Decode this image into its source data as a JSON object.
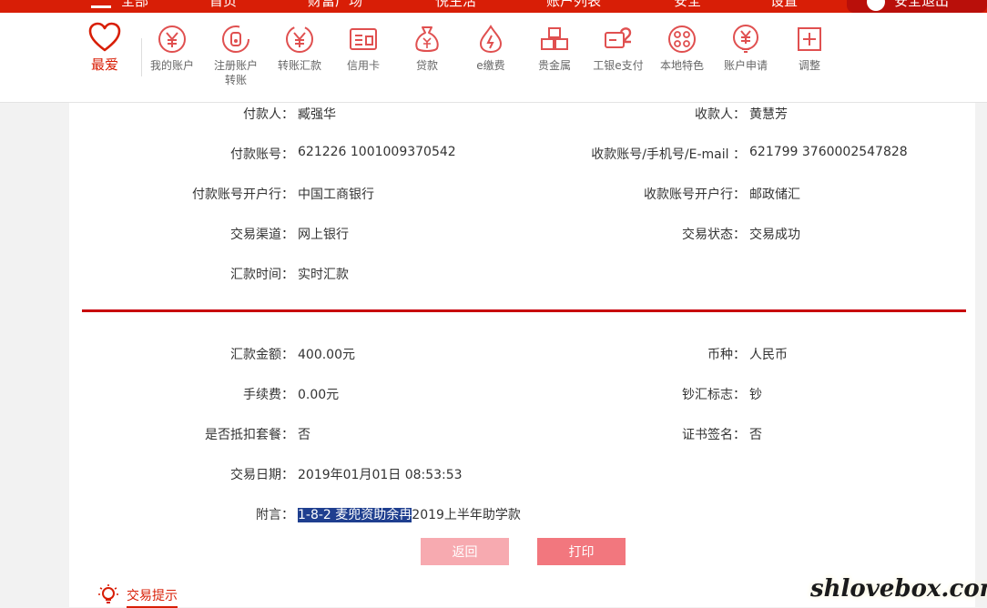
{
  "topbar": {
    "nav": [
      "全部",
      "首页",
      "财富广场",
      "悦生活",
      "账户列表",
      "安全",
      "设置"
    ],
    "logout": "安全退出"
  },
  "funcbar": {
    "favorite": "最爱",
    "items": [
      {
        "label": "我的账户",
        "icon": "yuan-circle-icon"
      },
      {
        "label": "注册账户\n转账",
        "icon": "register-transfer-icon"
      },
      {
        "label": "转账汇款",
        "icon": "transfer-icon"
      },
      {
        "label": "信用卡",
        "icon": "credit-card-icon"
      },
      {
        "label": "贷款",
        "icon": "money-bag-icon"
      },
      {
        "label": "e缴费",
        "icon": "payment-drop-icon"
      },
      {
        "label": "贵金属",
        "icon": "gold-bars-icon"
      },
      {
        "label": "工银e支付",
        "icon": "epay-icon"
      },
      {
        "label": "本地特色",
        "icon": "local-icon"
      },
      {
        "label": "账户申请",
        "icon": "account-apply-icon"
      },
      {
        "label": "调整",
        "icon": "plus-box-icon"
      }
    ]
  },
  "details": {
    "payer_label": "付款人：",
    "payer": "臧强华",
    "payee_label": "收款人：",
    "payee": "黄慧芳",
    "payer_account_label": "付款账号：",
    "payer_account": "621226 1001009370542",
    "payee_account_label": "收款账号/手机号/E-mail ：",
    "payee_account": "621799 3760002547828",
    "payer_bank_label": "付款账号开户行：",
    "payer_bank": "中国工商银行",
    "payee_bank_label": "收款账号开户行：",
    "payee_bank": "邮政储汇",
    "channel_label": "交易渠道：",
    "channel": "网上银行",
    "status_label": "交易状态：",
    "status": "交易成功",
    "time_label": "汇款时间：",
    "time": "实时汇款"
  },
  "amounts": {
    "amount_label": "汇款金额：",
    "amount": "400.00元",
    "currency_label": "币种：",
    "currency": "人民币",
    "fee_label": "手续费：",
    "fee": "0.00元",
    "cash_flag_label": "钞汇标志：",
    "cash_flag": "钞",
    "package_label": "是否抵扣套餐：",
    "package": "否",
    "cert_label": "证书签名：",
    "cert": "否",
    "date_label": "交易日期：",
    "date": "2019年01月01日 08:53:53",
    "memo_label": "附言：",
    "memo_highlighted": "1-8-2 麦兜资助余冉",
    "memo_rest": "2019上半年助学款"
  },
  "buttons": {
    "back": "返回",
    "print": "打印"
  },
  "tips": {
    "label": "交易提示"
  },
  "watermark": "shlovebox.com",
  "colors": {
    "brand_red": "#d81e06",
    "divider_red": "#c8000b",
    "back_button": "#f7aab0",
    "print_button": "#f2777e",
    "selection": "#1f3f8f"
  }
}
